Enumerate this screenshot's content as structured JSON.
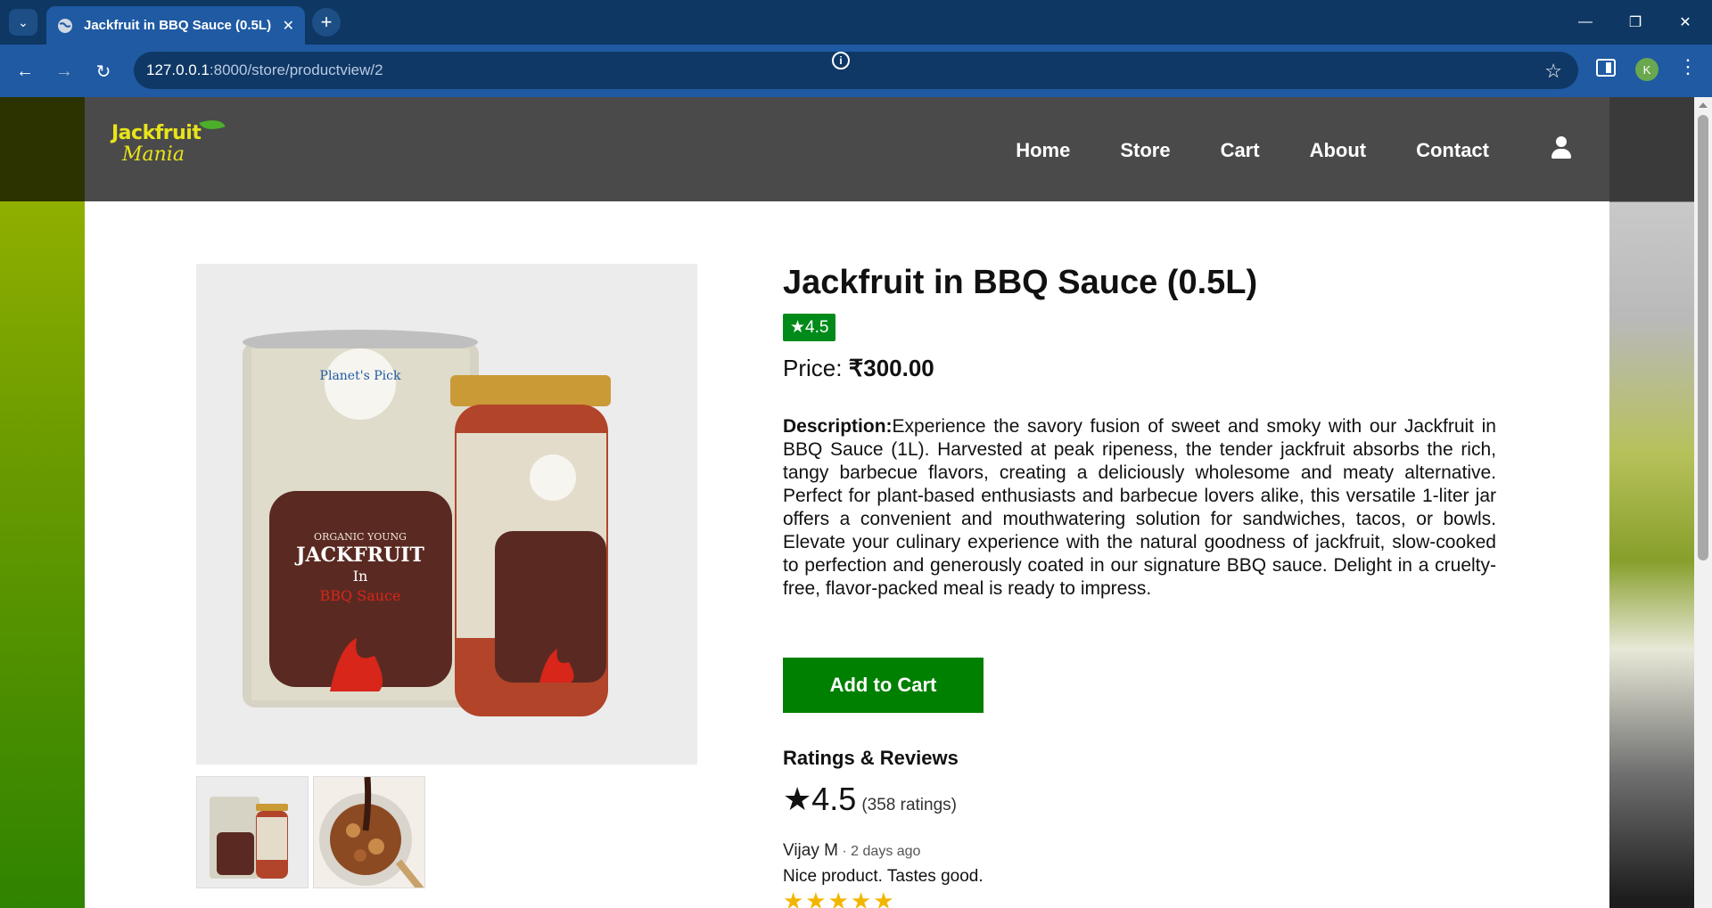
{
  "browser": {
    "tab_title": "Jackfruit in BBQ Sauce (0.5L) (",
    "url_host": "127.0.0.1",
    "url_rest": ":8000/store/productview/2",
    "profile_initial": "K",
    "icons": [
      "tab-search-icon",
      "globe-icon",
      "close-icon",
      "new-tab-icon",
      "minimize-icon",
      "restore-icon",
      "window-close-icon",
      "back-icon",
      "forward-icon",
      "reload-icon",
      "site-info-icon",
      "bookmark-star-icon",
      "side-panel-icon",
      "menu-icon"
    ]
  },
  "site": {
    "logo_line1": "Jackfruit",
    "logo_line2": "Mania",
    "nav": [
      "Home",
      "Store",
      "Cart",
      "About",
      "Contact"
    ],
    "accent_color": "#008000",
    "navbar_color": "#4a4a4a"
  },
  "product": {
    "title": "Jackfruit in BBQ Sauce (0.5L)",
    "rating_badge": "★4.5",
    "price_label": "Price: ",
    "price_value": "₹300.00",
    "description_label": "Description:",
    "description": "Experience the savory fusion of sweet and smoky with our Jackfruit in BBQ Sauce (1L). Harvested at peak ripeness, the tender jackfruit absorbs the rich, tangy barbecue flavors, creating a deliciously wholesome and meaty alternative. Perfect for plant-based enthusiasts and barbecue lovers alike, this versatile 1-liter jar offers a convenient and mouthwatering solution for sandwiches, tacos, or bowls. Elevate your culinary experience with the natural goodness of jackfruit, slow-cooked to perfection and generously coated in our signature BBQ sauce. Delight in a cruelty-free, flavor-packed meal is ready to impress.",
    "add_to_cart": "Add to Cart",
    "image_text": {
      "brand": "Planet's Pick",
      "line1": "ORGANIC YOUNG",
      "line2": "JACKFRUIT",
      "line3": "In",
      "line4": "BBQ Sauce"
    }
  },
  "reviews": {
    "heading": "Ratings & Reviews",
    "score": "★4.5",
    "count": "(358 ratings)",
    "items": [
      {
        "author": "Vijay M",
        "time": " · 2 days ago",
        "text": "Nice product. Tastes good.",
        "stars": "★★★★★",
        "rating": 5
      }
    ]
  }
}
